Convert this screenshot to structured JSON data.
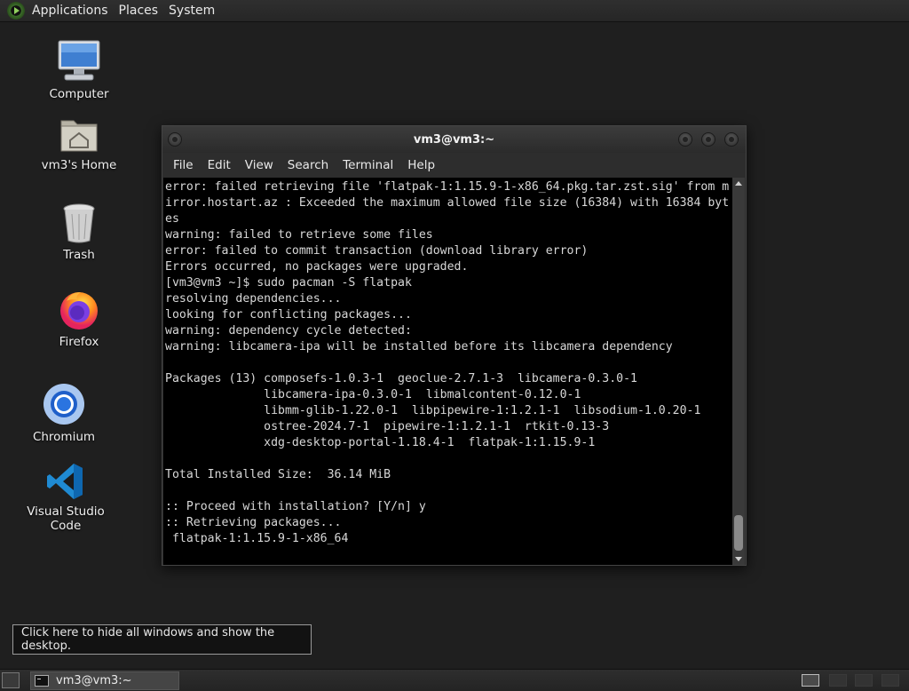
{
  "top_panel": {
    "menus": [
      "Applications",
      "Places",
      "System"
    ]
  },
  "desktop_icons": [
    {
      "label": "Computer",
      "icon": "computer-icon"
    },
    {
      "label": "vm3's Home",
      "icon": "home-folder-icon"
    },
    {
      "label": "Trash",
      "icon": "trash-icon"
    },
    {
      "label": "Firefox",
      "icon": "firefox-icon"
    },
    {
      "label": "Chromium",
      "icon": "chromium-icon"
    },
    {
      "label": "Visual Studio Code",
      "icon": "vscode-icon"
    }
  ],
  "terminal": {
    "title": "vm3@vm3:~",
    "menus": [
      "File",
      "Edit",
      "View",
      "Search",
      "Terminal",
      "Help"
    ],
    "lines": [
      "error: failed retrieving file 'flatpak-1:1.15.9-1-x86_64.pkg.tar.zst.sig' from m",
      "irror.hostart.az : Exceeded the maximum allowed file size (16384) with 16384 byt",
      "es",
      "warning: failed to retrieve some files",
      "error: failed to commit transaction (download library error)",
      "Errors occurred, no packages were upgraded.",
      "[vm3@vm3 ~]$ sudo pacman -S flatpak",
      "resolving dependencies...",
      "looking for conflicting packages...",
      "warning: dependency cycle detected:",
      "warning: libcamera-ipa will be installed before its libcamera dependency",
      "",
      "Packages (13) composefs-1.0.3-1  geoclue-2.7.1-3  libcamera-0.3.0-1",
      "              libcamera-ipa-0.3.0-1  libmalcontent-0.12.0-1",
      "              libmm-glib-1.22.0-1  libpipewire-1:1.2.1-1  libsodium-1.0.20-1",
      "              ostree-2024.7-1  pipewire-1:1.2.1-1  rtkit-0.13-3",
      "              xdg-desktop-portal-1.18.4-1  flatpak-1:1.15.9-1",
      "",
      "Total Installed Size:  36.14 MiB",
      "",
      ":: Proceed with installation? [Y/n] y",
      ":: Retrieving packages...",
      " flatpak-1:1.15.9-1-x86_64"
    ]
  },
  "tooltip": {
    "text": "Click here to hide all windows and show the desktop."
  },
  "taskbar": {
    "window_label": "vm3@vm3:~"
  }
}
